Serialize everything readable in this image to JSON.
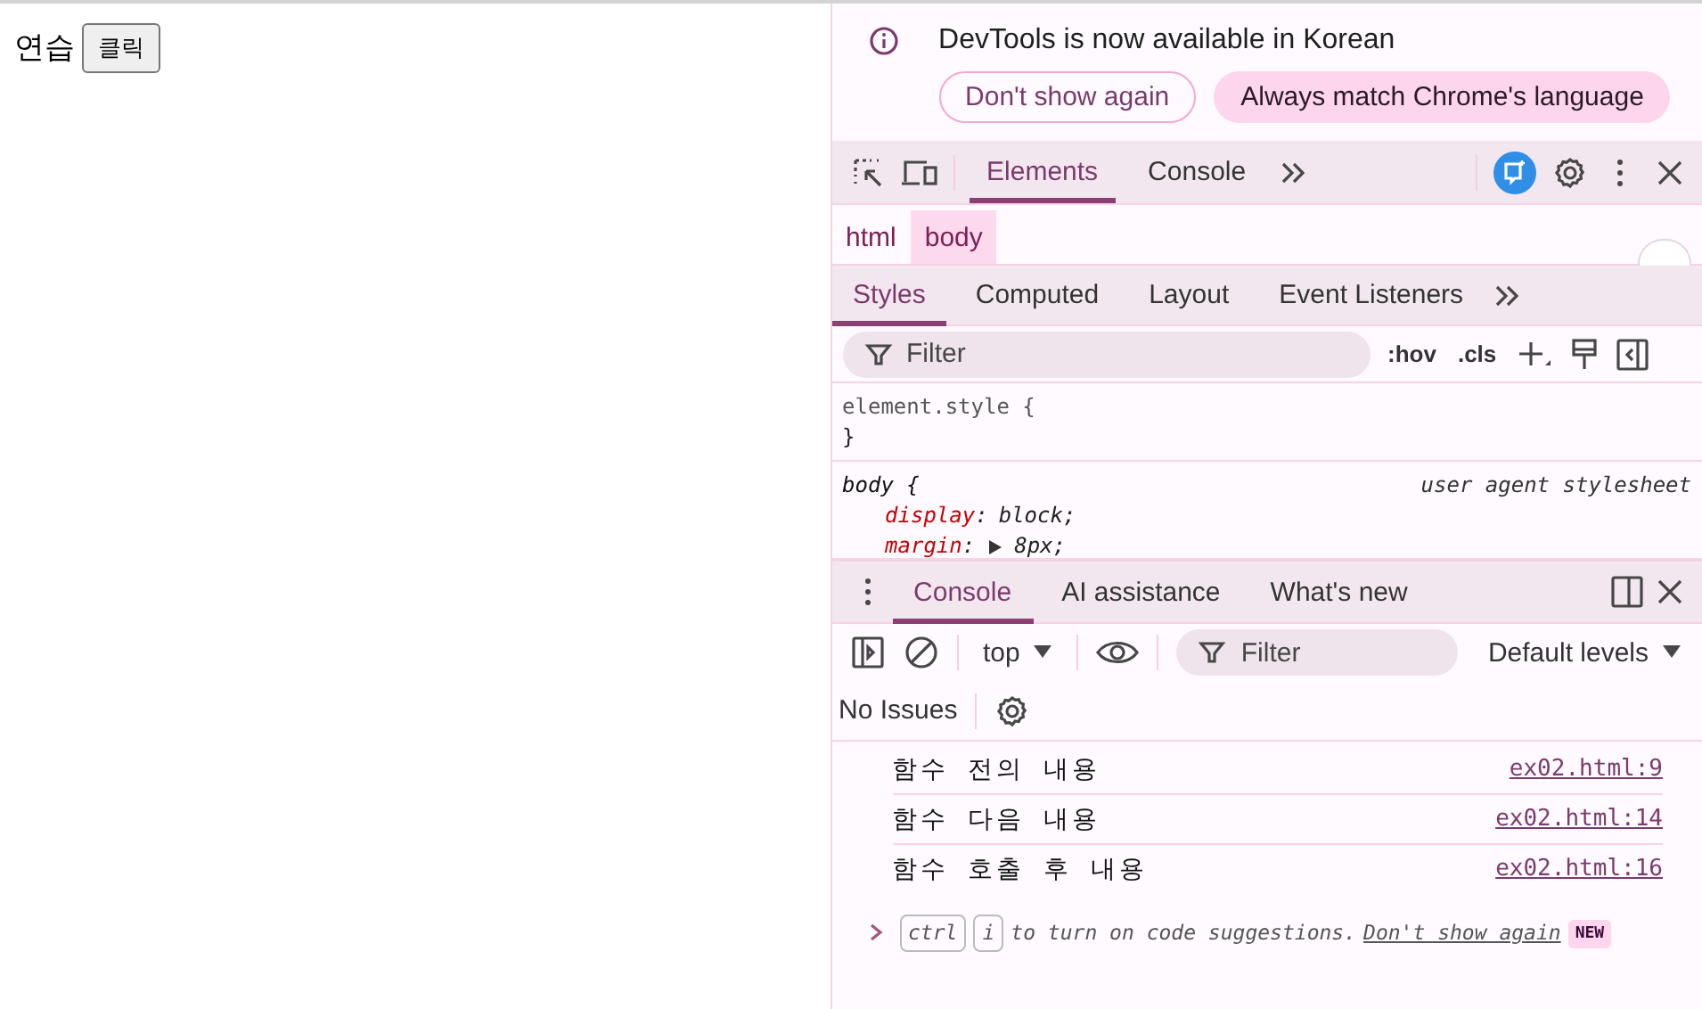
{
  "page": {
    "label": "연습",
    "button": "클릭"
  },
  "infobar": {
    "message": "DevTools is now available in Korean",
    "buttons": [
      {
        "label": "Don't show again",
        "kind": "outline"
      },
      {
        "label": "Always match Chrome's language",
        "kind": "filled"
      }
    ]
  },
  "main_tabs": [
    {
      "label": "Elements",
      "selected": true
    },
    {
      "label": "Console",
      "selected": false
    }
  ],
  "breadcrumbs": [
    {
      "label": "html",
      "selected": false
    },
    {
      "label": "body",
      "selected": true
    }
  ],
  "styles_tabs": [
    {
      "label": "Styles",
      "selected": true
    },
    {
      "label": "Computed",
      "selected": false
    },
    {
      "label": "Layout",
      "selected": false
    },
    {
      "label": "Event Listeners",
      "selected": false
    }
  ],
  "styles_filter": {
    "placeholder": "Filter"
  },
  "styles_buttons": [
    ":hov",
    ".cls"
  ],
  "rules": [
    {
      "selector": "element.style {",
      "close": "}"
    },
    {
      "selector": "body {",
      "origin": "user agent stylesheet",
      "declarations": [
        {
          "property": "display",
          "separator": ":",
          "value": "block;",
          "expandable": false
        },
        {
          "property": "margin",
          "separator": ":",
          "value": "8px;",
          "expandable": true
        }
      ]
    }
  ],
  "drawer_tabs": [
    {
      "label": "Console",
      "selected": true
    },
    {
      "label": "AI assistance",
      "selected": false
    },
    {
      "label": "What's new",
      "selected": false
    }
  ],
  "console_toolbar": {
    "context": "top",
    "filter": {
      "placeholder": "Filter"
    },
    "levels": "Default levels"
  },
  "issues": "No Issues",
  "messages": [
    {
      "text": "함수 전의 내용",
      "source": "ex02.html:9"
    },
    {
      "text": "함수 다음 내용",
      "source": "ex02.html:14"
    },
    {
      "text": "함수 호출 후 내용",
      "source": "ex02.html:16"
    }
  ],
  "prompt": {
    "keys": [
      "ctrl",
      "i"
    ],
    "hint": "to turn on code suggestions.",
    "link": "Don't show again",
    "badge": "NEW"
  }
}
